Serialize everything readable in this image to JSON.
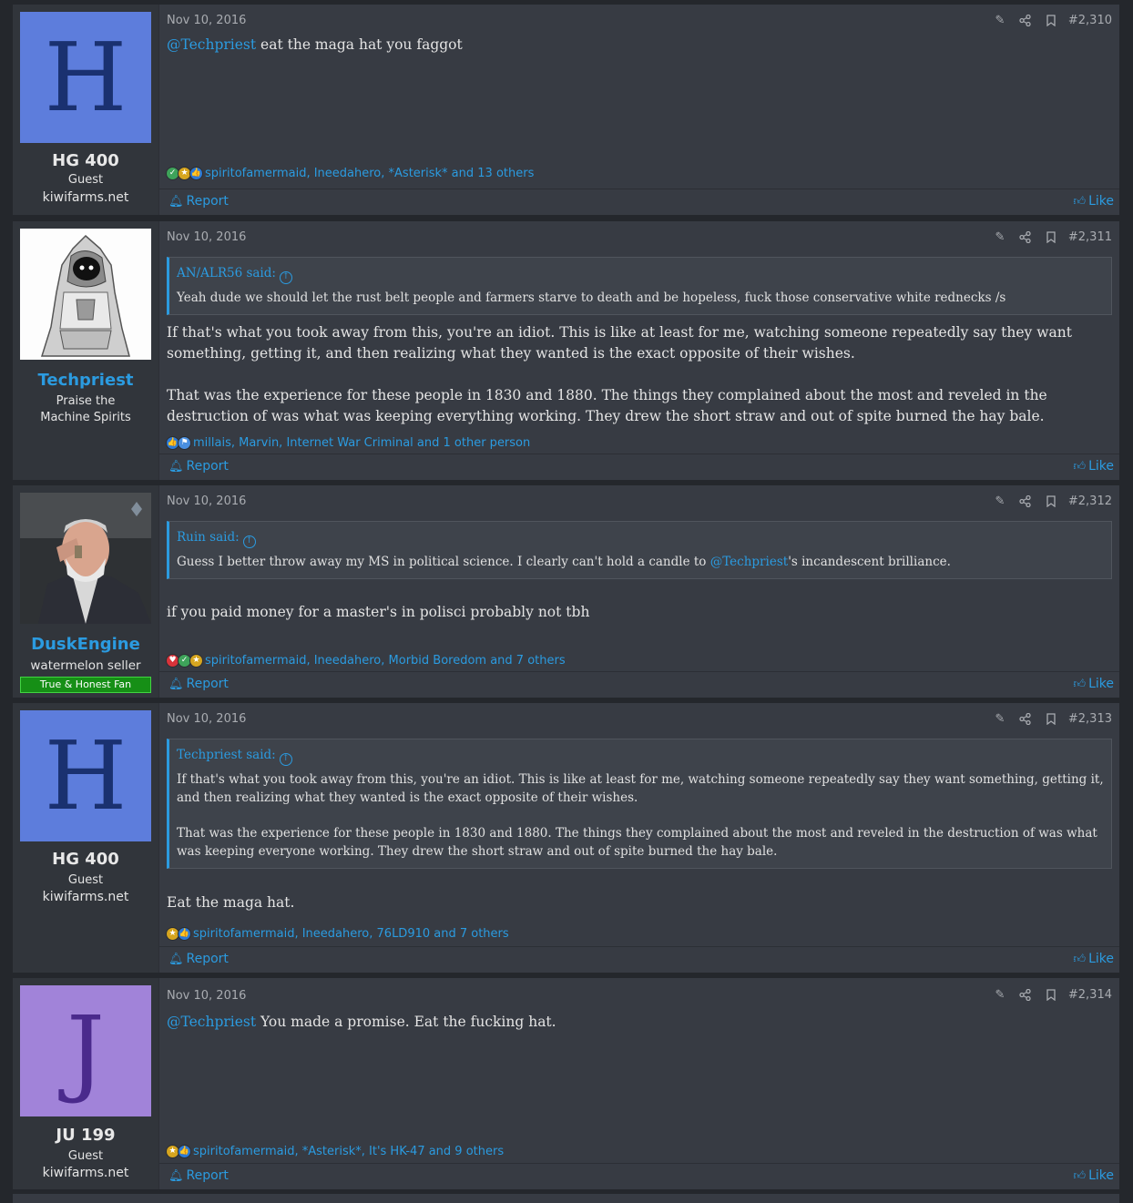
{
  "colors": {
    "accent": "#2b9be0",
    "avatar_h": "#5d7ddc",
    "avatar_j": "#a183d9",
    "letter_h": "#1a3170",
    "letter_j": "#4a2a8c",
    "banner": "#168f16"
  },
  "icons": {
    "edit": "pencil-icon",
    "share": "share-icon",
    "bookmark": "bookmark-icon",
    "report": "bell-icon",
    "like": "thumbs-up-icon"
  },
  "footer": {
    "report_label": "Report",
    "like_label": "Like"
  },
  "posts": [
    {
      "avatar_letter": "H",
      "username": "HG 400",
      "user_title": "Guest",
      "user_extra": "kiwifarms.net",
      "date": "Nov 10, 2016",
      "post_number": "#2,310",
      "mention": "@Techpriest",
      "body": " eat the maga hat you faggot",
      "reaction_icons": [
        "check-icon",
        "medal-icon",
        "thumbs-up-icon"
      ],
      "reactions": "spiritofamermaid, Ineedahero, *Asterisk* and 13 others"
    },
    {
      "username": "Techpriest",
      "user_title": "Praise the Machine Spirits",
      "date": "Nov 10, 2016",
      "post_number": "#2,311",
      "quote_author": "AN/ALR56 said:",
      "quote_text": "Yeah dude we should let the rust belt people and farmers starve to death and be hopeless, fuck those conservative white rednecks /s",
      "body_p1": "If that's what you took away from this, you're an idiot. This is like at least for me, watching someone repeatedly say they want something, getting it, and then realizing what they wanted is the exact opposite of their wishes.",
      "body_p2": "That was the experience for these people in 1830 and 1880. The things they complained about the most and reveled in the destruction of was what was keeping everything working. They drew the short straw and out of spite burned the hay bale.",
      "reaction_icons": [
        "thumbs-up-icon",
        "flag-icon"
      ],
      "reactions": "millais, Marvin, Internet War Criminal and 1 other person"
    },
    {
      "username": "DuskEngine",
      "user_title": "watermelon seller",
      "banner": "True & Honest Fan",
      "date": "Nov 10, 2016",
      "post_number": "#2,312",
      "quote_author": "Ruin said:",
      "quote_text_pre": "Guess I better throw away my MS in political science. I clearly can't hold a candle to ",
      "quote_mention": "@Techpriest",
      "quote_text_post": "'s incandescent brilliance.",
      "body": "if you paid money for a master's in polisci probably not tbh",
      "reaction_icons": [
        "heart-icon",
        "check-icon",
        "medal-icon"
      ],
      "reactions": "spiritofamermaid, Ineedahero, Morbid Boredom and 7 others"
    },
    {
      "avatar_letter": "H",
      "username": "HG 400",
      "user_title": "Guest",
      "user_extra": "kiwifarms.net",
      "date": "Nov 10, 2016",
      "post_number": "#2,313",
      "quote_author": "Techpriest said:",
      "quote_p1": "If that's what you took away from this, you're an idiot. This is like at least for me, watching someone repeatedly say they want something, getting it, and then realizing what they wanted is the exact opposite of their wishes.",
      "quote_p2": "That was the experience for these people in 1830 and 1880. The things they complained about the most and reveled in the destruction of was what was keeping everyone working. They drew the short straw and out of spite burned the hay bale.",
      "body": "Eat the maga hat.",
      "reaction_icons": [
        "medal-icon",
        "thumbs-up-icon"
      ],
      "reactions": "spiritofamermaid, Ineedahero, 76LD910 and 7 others"
    },
    {
      "avatar_letter": "J",
      "username": "JU 199",
      "user_title": "Guest",
      "user_extra": "kiwifarms.net",
      "date": "Nov 10, 2016",
      "post_number": "#2,314",
      "mention": "@Techpriest",
      "body": " You made a promise. Eat the fucking hat.",
      "reaction_icons": [
        "medal-icon",
        "thumbs-up-icon"
      ],
      "reactions": "spiritofamermaid, *Asterisk*, It's HK-47 and 9 others"
    }
  ]
}
